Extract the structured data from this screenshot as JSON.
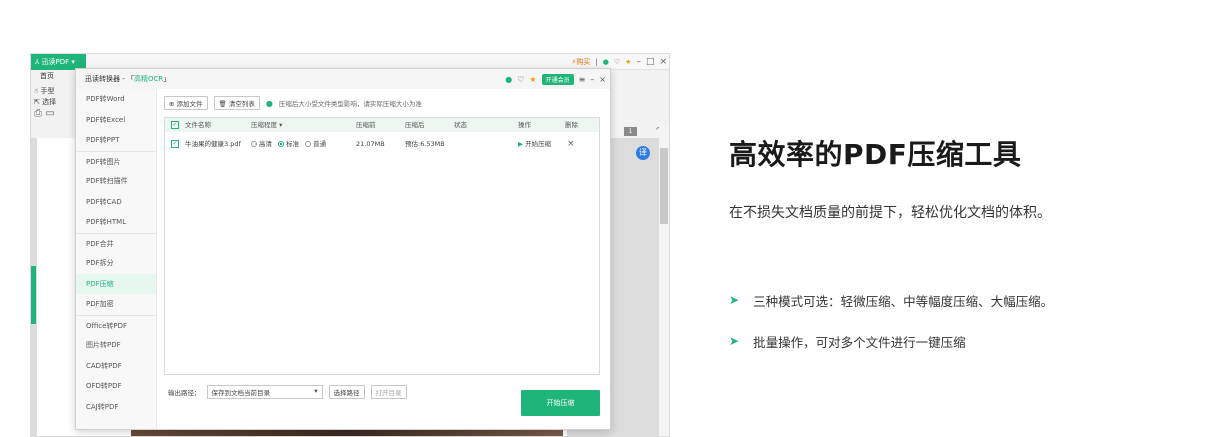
{
  "app": {
    "brand": "迅读PDF",
    "buy": "购买",
    "menu_home": "首页",
    "tool_hand": "手型",
    "tool_select": "选择",
    "page_num": "1"
  },
  "dialog": {
    "title_prefix": "迅读转换器 - 「",
    "title_ocr": "高精OCR",
    "title_suffix": "」",
    "vip_label": "开通会员",
    "sidebar": [
      {
        "label": "PDF转Word"
      },
      {
        "label": "PDF转Excel"
      },
      {
        "label": "PDF转PPT"
      },
      {
        "label": "PDF转图片"
      },
      {
        "label": "PDF转扫描件"
      },
      {
        "label": "PDF转CAD"
      },
      {
        "label": "PDF转HTML"
      },
      {
        "label": "PDF合并"
      },
      {
        "label": "PDF拆分"
      },
      {
        "label": "PDF压缩"
      },
      {
        "label": "PDF加密"
      },
      {
        "label": "Office转PDF"
      },
      {
        "label": "图片转PDF"
      },
      {
        "label": "CAD转PDF"
      },
      {
        "label": "OFD转PDF"
      },
      {
        "label": "CAJ转PDF"
      }
    ],
    "active_item": "PDF压缩",
    "add_file": "添加文件",
    "clear_list": "清空列表",
    "hint": "压缩后大小受文件类型影响，请实际压缩大小为准",
    "columns": {
      "name": "文件名称",
      "level": "压缩程度",
      "before": "压缩前",
      "after": "压缩后",
      "status": "状态",
      "action": "操作",
      "delete": "删除"
    },
    "row": {
      "filename": "牛油果的健康3.pdf",
      "opt_clear": "高清",
      "opt_standard": "标准",
      "opt_normal": "普通",
      "before": "21.07MB",
      "after": "预估:6.53MB",
      "status": "",
      "action": "开始压缩"
    },
    "output_label": "输出路径：",
    "output_value": "保存到文档当前目录",
    "choose_path": "选择路径",
    "open_dir": "打开目录",
    "start": "开始压缩"
  },
  "marketing": {
    "headline": "高效率的PDF压缩工具",
    "subline": "在不损失文档质量的前提下，轻松优化文档的体积。",
    "bullets": [
      "三种模式可选：轻微压缩、中等幅度压缩、大幅压缩。",
      "批量操作，可对多个文件进行一键压缩"
    ]
  },
  "colors": {
    "accent": "#1fb57a",
    "buy": "#e2700e"
  }
}
